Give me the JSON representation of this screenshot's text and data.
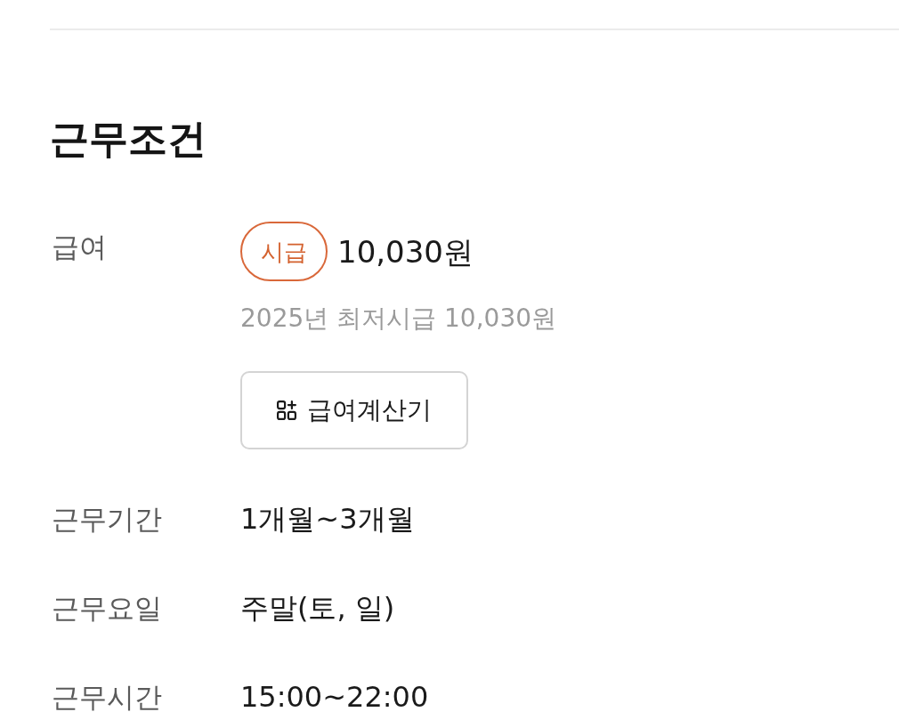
{
  "section": {
    "title": "근무조건"
  },
  "rows": [
    {
      "kind": "salary",
      "label": "급여",
      "badge": "시급",
      "amount": "10,030원",
      "note": "2025년 최저시급 10,030원",
      "button": "급여계산기"
    },
    {
      "kind": "text",
      "label": "근무기간",
      "value": "1개월~3개월"
    },
    {
      "kind": "text",
      "label": "근무요일",
      "value": "주말(토, 일)"
    },
    {
      "kind": "text",
      "label": "근무시간",
      "value": "15:00~22:00"
    }
  ]
}
